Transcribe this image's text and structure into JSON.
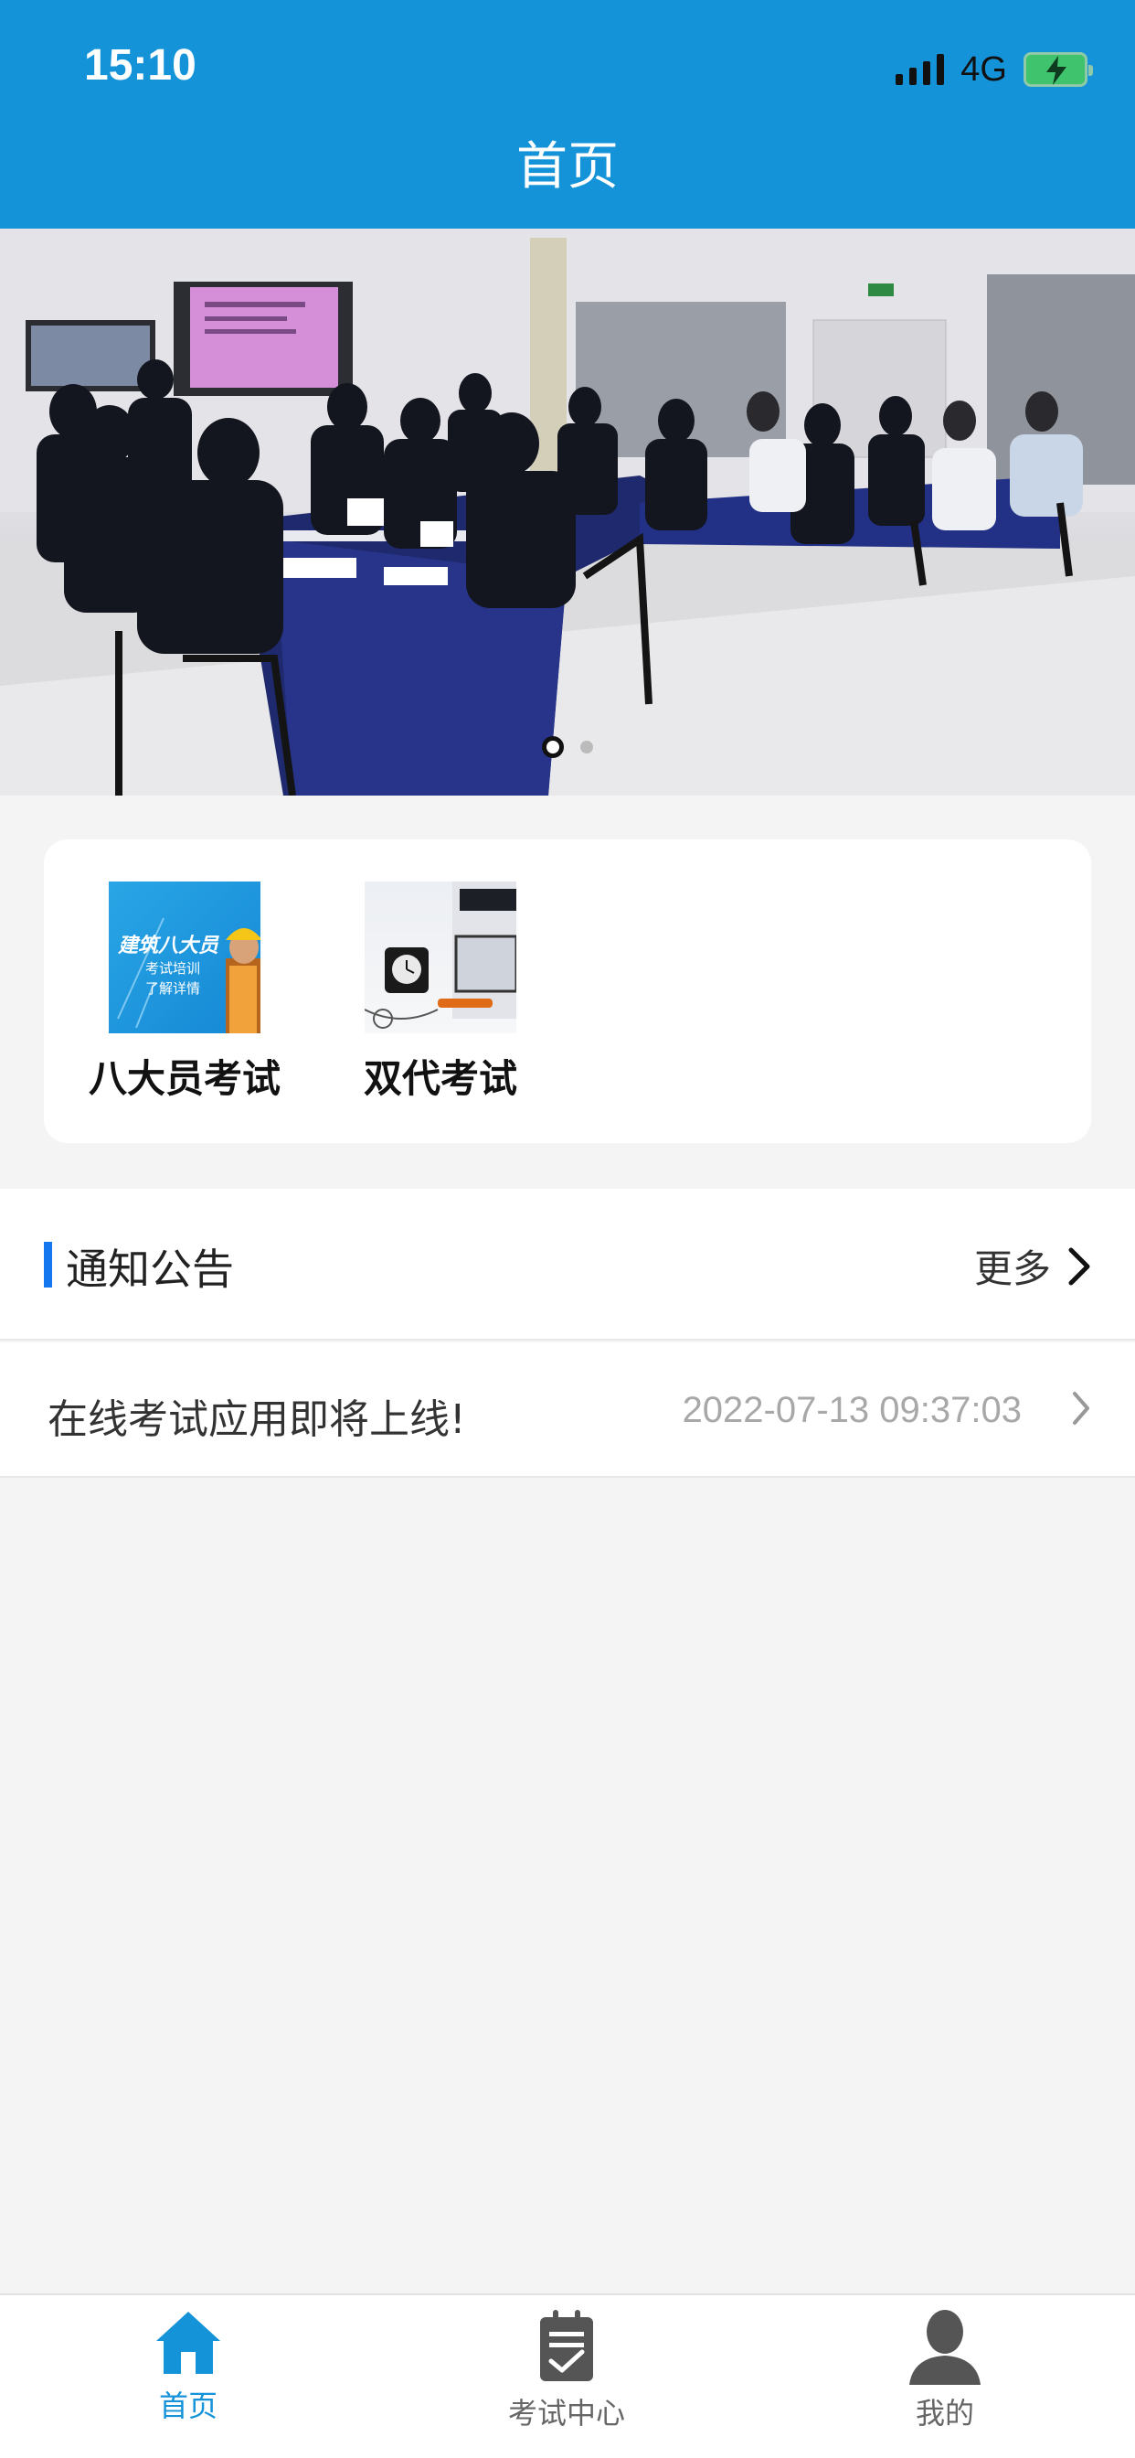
{
  "status_bar": {
    "time": "15:10",
    "network": "4G"
  },
  "header": {
    "title": "首页"
  },
  "banner": {
    "slide_count": 2,
    "active_slide": 1
  },
  "categories": [
    {
      "label": "八大员考试",
      "thumb_title": "建筑八大员",
      "thumb_sub1": "考试培训",
      "thumb_sub2": "了解详情"
    },
    {
      "label": "双代考试"
    }
  ],
  "notice": {
    "title": "通知公告",
    "more": "更多",
    "items": [
      {
        "text": "在线考试应用即将上线!",
        "date": "2022-07-13 09:37:03"
      }
    ]
  },
  "tabbar": {
    "items": [
      {
        "label": "首页",
        "icon": "home-icon",
        "active": true
      },
      {
        "label": "考试中心",
        "icon": "clipboard-icon",
        "active": false
      },
      {
        "label": "我的",
        "icon": "user-icon",
        "active": false
      }
    ]
  },
  "colors": {
    "primary": "#1593d9",
    "accent_bar": "#1577f0",
    "background": "#f4f4f4"
  }
}
